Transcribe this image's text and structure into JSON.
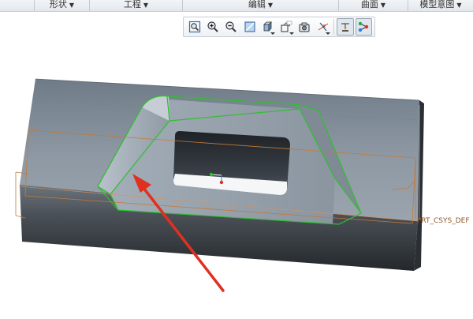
{
  "ribbon": {
    "groups": [
      {
        "label": "形状",
        "arrow": "▼"
      },
      {
        "label": "工程",
        "arrow": "▼"
      },
      {
        "label": "编辑",
        "arrow": "▼"
      },
      {
        "label": "曲面",
        "arrow": "▼"
      },
      {
        "label": "模型意图",
        "arrow": "▼"
      }
    ]
  },
  "toolbar": {
    "buttons": [
      {
        "name": "refit-icon"
      },
      {
        "name": "zoom-in-icon"
      },
      {
        "name": "zoom-out-icon"
      },
      {
        "name": "repaint-icon"
      },
      {
        "name": "display-style-icon"
      },
      {
        "name": "saved-orientations-icon"
      },
      {
        "name": "view-manager-icon"
      },
      {
        "name": "datum-display-icon"
      },
      {
        "name": "annotation-display-icon"
      },
      {
        "name": "spin-center-icon"
      }
    ]
  },
  "viewport": {
    "csys_label": "PRT_CSYS_DEF",
    "colors": {
      "model_top": "#8a95a0",
      "model_front": "#3a3f45",
      "highlight": "#2fbf2f",
      "datum_plane": "#c27a3a",
      "annotation_arrow": "#e03020"
    }
  }
}
